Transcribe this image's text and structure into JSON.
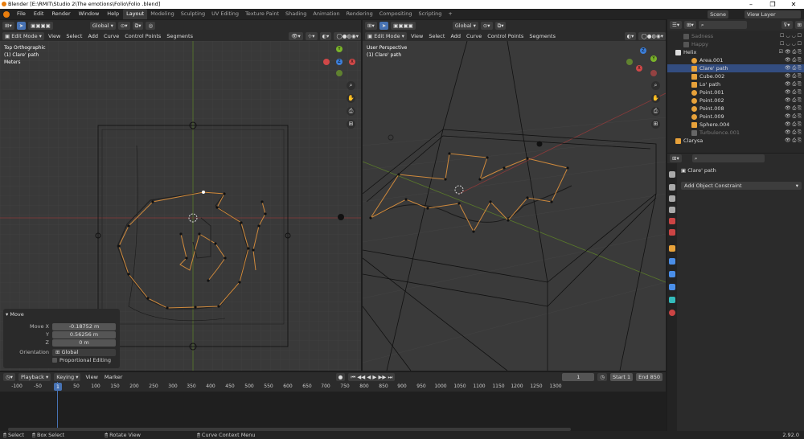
{
  "title": "Blender [E:\\RMIT\\Studio 2\\The emotions\\Folio\\Folio .blend]",
  "window_controls": [
    "–",
    "❐",
    "✕"
  ],
  "menus": [
    "File",
    "Edit",
    "Render",
    "Window",
    "Help"
  ],
  "workspaces": [
    "Layout",
    "Modeling",
    "Sculpting",
    "UV Editing",
    "Texture Paint",
    "Shading",
    "Animation",
    "Rendering",
    "Compositing",
    "Scripting"
  ],
  "scene": {
    "label": "Scene",
    "view_layer": "View Layer"
  },
  "left_view": {
    "mode": "Edit Mode",
    "menus": [
      "View",
      "Select",
      "Add",
      "Curve",
      "Control Points",
      "Segments"
    ],
    "transform": "Global",
    "overlay": [
      "Top Orthographic",
      "(1) Clare' path",
      "Meters"
    ]
  },
  "right_view": {
    "mode": "Edit Mode",
    "menus": [
      "View",
      "Select",
      "Add",
      "Curve",
      "Control Points",
      "Segments"
    ],
    "transform": "Global",
    "overlay": [
      "User Perspective",
      "(1) Clare' path"
    ]
  },
  "operator_panel": {
    "title": "Move",
    "fields": [
      {
        "label": "Move X",
        "value": "-0.18752 m"
      },
      {
        "label": "Y",
        "value": "0.56256 m"
      },
      {
        "label": "Z",
        "value": "0 m"
      }
    ],
    "orientation_label": "Orientation",
    "orientation_value": "Global",
    "proportional_label": "Proportional Editing"
  },
  "timeline": {
    "menus": [
      "Playback",
      "Keying",
      "View",
      "Marker"
    ],
    "current_frame": "1",
    "start_label": "Start",
    "start": "1",
    "end_label": "End",
    "end": "850",
    "ticks": [
      "-100",
      "-50",
      "1",
      "50",
      "100",
      "150",
      "200",
      "250",
      "300",
      "350",
      "400",
      "450",
      "500",
      "550",
      "600",
      "650",
      "700",
      "750",
      "800",
      "850",
      "900",
      "950",
      "1000",
      "1050",
      "1100",
      "1150",
      "1200",
      "1250",
      "1300"
    ]
  },
  "status": {
    "select": "Select",
    "box_select": "Box Select",
    "rotate": "Rotate View",
    "context": "Curve Context Menu",
    "version": "2.92.0"
  },
  "outliner": {
    "items": [
      {
        "name": "Sadness",
        "dim": true
      },
      {
        "name": "Happy",
        "dim": true
      },
      {
        "name": "Helix",
        "dim": false
      },
      {
        "name": "Area.001",
        "dim": false
      },
      {
        "name": "Clare' path",
        "dim": false,
        "selected": true
      },
      {
        "name": "Cube.002",
        "dim": false
      },
      {
        "name": "Lo' path",
        "dim": false
      },
      {
        "name": "Point.001",
        "dim": false
      },
      {
        "name": "Point.002",
        "dim": false
      },
      {
        "name": "Point.008",
        "dim": false
      },
      {
        "name": "Point.009",
        "dim": false
      },
      {
        "name": "Sphere.004",
        "dim": false
      },
      {
        "name": "Turbulence.001",
        "dim": true
      },
      {
        "name": "Clarysa",
        "dim": false
      }
    ]
  },
  "properties": {
    "object_name": "Clare' path",
    "add_constraint": "Add Object Constraint"
  },
  "colors": {
    "accent": "#4772b3",
    "selection": "#e8a23a",
    "curve": "#d08a3c",
    "x_axis": "#d04848",
    "y_axis": "#7ab32a",
    "z_axis": "#3c7ed8"
  }
}
